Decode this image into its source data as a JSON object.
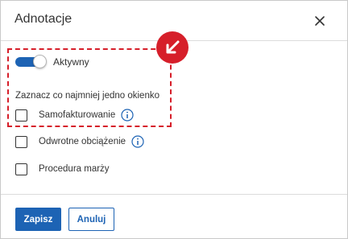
{
  "dialog": {
    "title": "Adnotacje",
    "close_icon": "close-icon"
  },
  "toggle": {
    "label": "Aktywny",
    "checked": true
  },
  "hint": "Zaznacz co najmniej jedno okienko",
  "options": [
    {
      "label": "Samofakturowanie",
      "checked": false,
      "info_icon": "info-icon"
    },
    {
      "label": "Odwrotne obciążenie",
      "checked": false,
      "info_icon": "info-icon"
    },
    {
      "label": "Procedura marży",
      "checked": false
    }
  ],
  "footer": {
    "save_label": "Zapisz",
    "cancel_label": "Anuluj"
  },
  "colors": {
    "accent": "#1d63b4",
    "highlight": "#d61f2a"
  },
  "callout_icon": "arrow-down-left-icon"
}
